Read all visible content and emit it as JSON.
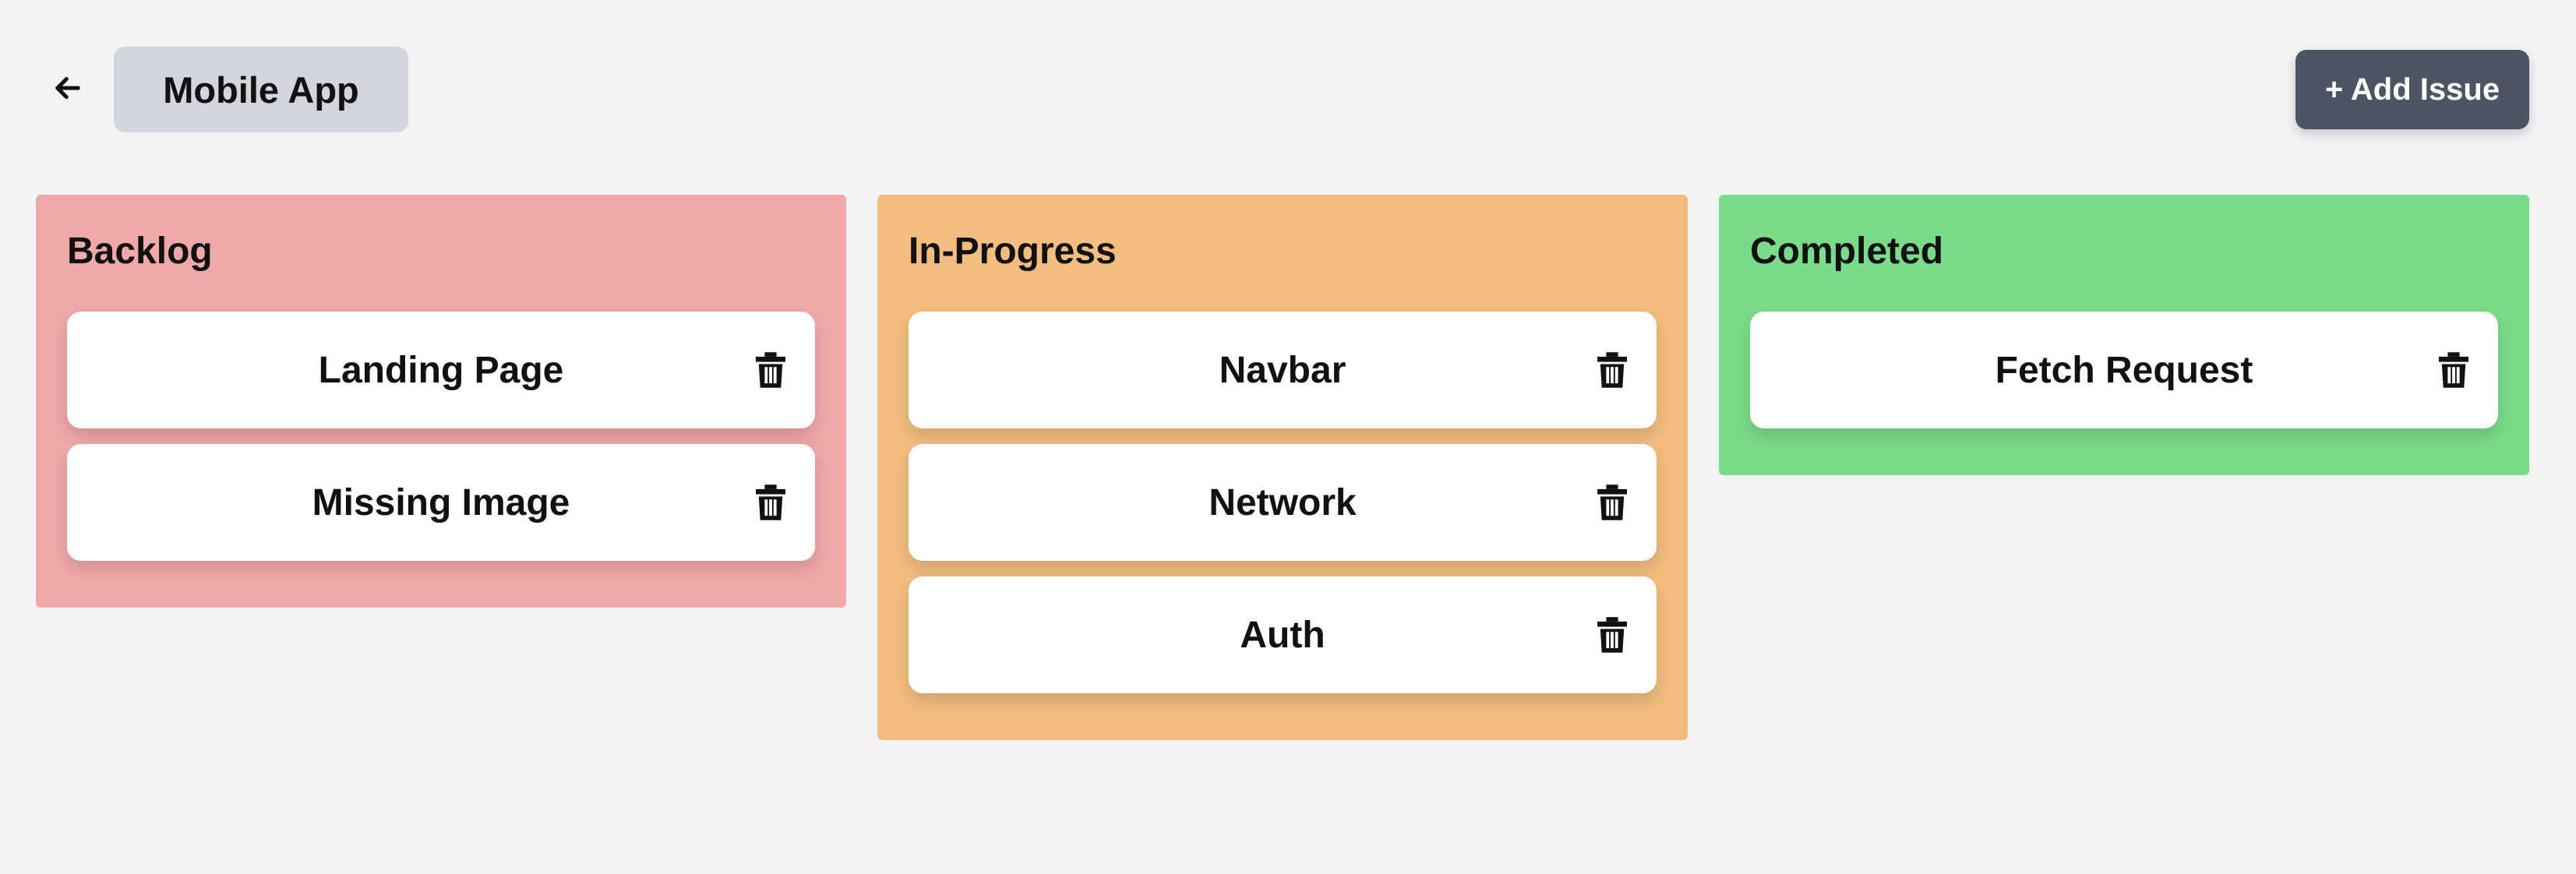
{
  "header": {
    "project_name": "Mobile App",
    "add_issue_label": "+ Add Issue",
    "back_icon": "arrow-left-icon"
  },
  "columns": [
    {
      "title": "Backlog",
      "color": "#f0a8a8",
      "cards": [
        {
          "title": "Landing Page"
        },
        {
          "title": "Missing Image"
        }
      ]
    },
    {
      "title": "In-Progress",
      "color": "#f2bd7e",
      "cards": [
        {
          "title": "Navbar"
        },
        {
          "title": "Network"
        },
        {
          "title": "Auth"
        }
      ]
    },
    {
      "title": "Completed",
      "color": "#7adb8a",
      "cards": [
        {
          "title": "Fetch Request"
        }
      ]
    }
  ],
  "colors": {
    "background": "#f2f3f5",
    "chip": "#d2d5db",
    "primary_button": "#4b5563",
    "card": "#ffffff"
  },
  "icons": {
    "delete": "trash-icon"
  }
}
